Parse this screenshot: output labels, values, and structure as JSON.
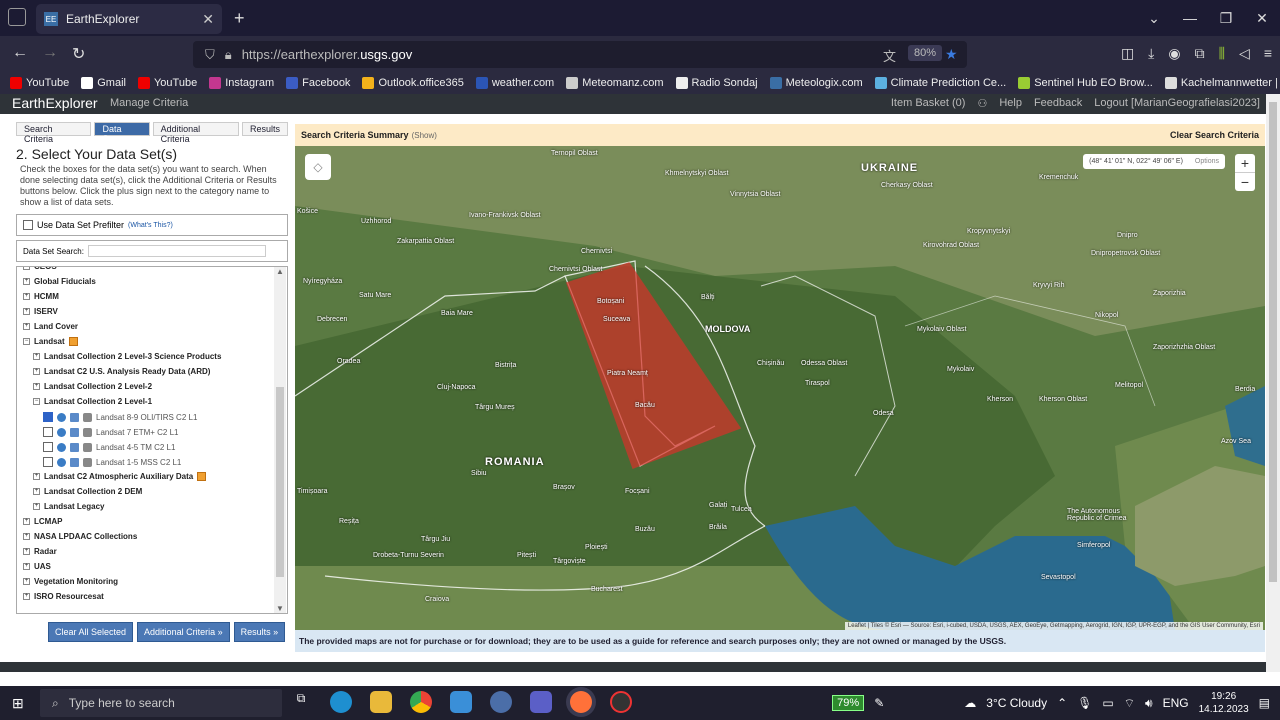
{
  "browser": {
    "tab_title": "EarthExplorer",
    "url_scheme": "https://earthexplorer.",
    "url_host": "usgs.gov",
    "zoom": "80%",
    "bookmarks": [
      {
        "label": "YouTube",
        "color": "#e00"
      },
      {
        "label": "Gmail",
        "color": "#fff"
      },
      {
        "label": "YouTube",
        "color": "#e00"
      },
      {
        "label": "Instagram",
        "color": "#c3378f"
      },
      {
        "label": "Facebook",
        "color": "#3b5cc4"
      },
      {
        "label": "Outlook.office365",
        "color": "#f3b21b"
      },
      {
        "label": "weather.com",
        "color": "#2b55b5"
      },
      {
        "label": "Meteomanz.com",
        "color": "#ccc"
      },
      {
        "label": "Radio Sondaj",
        "color": "#eee"
      },
      {
        "label": "Meteologix.com",
        "color": "#3a6ea5"
      },
      {
        "label": "Climate Prediction Ce...",
        "color": "#5cb0e0"
      },
      {
        "label": "Sentinel Hub EO Brow...",
        "color": "#9c3"
      },
      {
        "label": "Kachelmannwetter | W...",
        "color": "#ddd"
      }
    ]
  },
  "header": {
    "brand": "EarthExplorer",
    "manage": "Manage Criteria",
    "basket": "Item Basket (0)",
    "help": "Help",
    "feedback": "Feedback",
    "logout": "Logout [MarianGeografielasi2023]"
  },
  "left": {
    "tabs": [
      "Search Criteria",
      "Data Sets",
      "Additional Criteria",
      "Results"
    ],
    "title": "2. Select Your Data Set(s)",
    "instructions": "Check the boxes for the data set(s) you want to search. When done selecting data set(s), click the Additional Criteria or Results buttons below. Click the plus sign next to the category name to show a list of data sets.",
    "prefilter": "Use Data Set Prefilter",
    "whats_this": "(What's This?)",
    "search_label": "Data Set Search:",
    "tree": [
      {
        "label": "CEOS",
        "level": 0,
        "sign": "+"
      },
      {
        "label": "Global Fiducials",
        "level": 0,
        "sign": "+"
      },
      {
        "label": "HCMM",
        "level": 0,
        "sign": "+"
      },
      {
        "label": "ISERV",
        "level": 0,
        "sign": "+"
      },
      {
        "label": "Land Cover",
        "level": 0,
        "sign": "+"
      },
      {
        "label": "Landsat",
        "level": 0,
        "sign": "−",
        "badge": true
      },
      {
        "label": "Landsat Collection 2 Level-3 Science Products",
        "level": 1,
        "sign": "+"
      },
      {
        "label": "Landsat C2 U.S. Analysis Ready Data (ARD)",
        "level": 1,
        "sign": "+"
      },
      {
        "label": "Landsat Collection 2 Level-2",
        "level": 1,
        "sign": "+"
      },
      {
        "label": "Landsat Collection 2 Level-1",
        "level": 1,
        "sign": "−"
      },
      {
        "label": "Landsat 8-9 OLI/TIRS C2 L1",
        "level": 2,
        "checked": true
      },
      {
        "label": "Landsat 7 ETM+ C2 L1",
        "level": 2,
        "checked": false
      },
      {
        "label": "Landsat 4-5 TM C2 L1",
        "level": 2,
        "checked": false
      },
      {
        "label": "Landsat 1-5 MSS C2 L1",
        "level": 2,
        "checked": false
      },
      {
        "label": "Landsat C2 Atmospheric Auxiliary Data",
        "level": 1,
        "sign": "+",
        "badge": true
      },
      {
        "label": "Landsat Collection 2 DEM",
        "level": 1,
        "sign": "+"
      },
      {
        "label": "Landsat Legacy",
        "level": 1,
        "sign": "+"
      },
      {
        "label": "LCMAP",
        "level": 0,
        "sign": "+"
      },
      {
        "label": "NASA LPDAAC Collections",
        "level": 0,
        "sign": "+"
      },
      {
        "label": "Radar",
        "level": 0,
        "sign": "+"
      },
      {
        "label": "UAS",
        "level": 0,
        "sign": "+"
      },
      {
        "label": "Vegetation Monitoring",
        "level": 0,
        "sign": "+"
      },
      {
        "label": "ISRO Resourcesat",
        "level": 0,
        "sign": "+"
      }
    ],
    "buttons": [
      "Clear All Selected",
      "Additional Criteria »",
      "Results »"
    ]
  },
  "map": {
    "summary": "Search Criteria Summary",
    "show": "(Show)",
    "clear": "Clear Search Criteria",
    "coords": "(48° 41' 01\" N, 022° 49' 06\" E)",
    "options": "Options",
    "attribution": "Leaflet | Tiles © Esri — Source: Esri, i-cubed, USDA, USGS, AEX, GeoEye, Getmapping, Aerogrid, IGN, IGP, UPR-EGP, and the GIS User Community, Esri",
    "disclaimer": "The provided maps are not for purchase or for download; they are to be used as a guide for reference and search purposes only; they are not owned or managed by the USGS.",
    "labels": {
      "ukraine": "UKRAINE",
      "moldova": "MOLDOVA",
      "romania": "ROMANIA",
      "ternopil": "Ternopil Oblast",
      "khmelnytskyi": "Khmelnytskyi Oblast",
      "vinnytsia": "Vinnytsia Oblast",
      "cherkasy": "Cherkasy Oblast",
      "kremenchuk": "Kremenchuk",
      "kirovohrad": "Kirovohrad Oblast",
      "kropyvnytskyi": "Kropyvnytskyi",
      "dnipro": "Dnipro",
      "dnipropetrovsk": "Dnipropetrovsk Oblast",
      "kryvyi": "Kryvyi Rih",
      "zaporizhia": "Zaporizhia",
      "zaporizhia_obl": "Zaporizhzhia Oblast",
      "nikopol": "Nikopol",
      "ivano": "Ivano-Frankivsk Oblast",
      "uzhhorod": "Uzhhorod",
      "zakarpattia": "Zakarpattia Oblast",
      "chernivtsi": "Chernivtsi",
      "chernivtsi_obl": "Chernivtsi Oblast",
      "nyiregyhaza": "Nyíregyháza",
      "debrecen": "Debrecen",
      "satu": "Satu Mare",
      "baia": "Baia Mare",
      "oradea": "Oradea",
      "cluj": "Cluj-Napoca",
      "bistrita": "Bistrița",
      "targu": "Târgu Mureș",
      "botosani": "Botoșani",
      "suceava": "Suceava",
      "piatra": "Piatra Neamț",
      "bacau": "Bacău",
      "balti": "Bălți",
      "chisinau": "Chișinău",
      "odessa_obl": "Odessa Oblast",
      "odesa": "Odesa",
      "tiraspol": "Tiraspol",
      "mykolaiv_obl": "Mykolaiv Oblast",
      "mykolaiv": "Mykolaiv",
      "kherson": "Kherson",
      "kherson_obl": "Kherson Oblast",
      "melitopol": "Melitopol",
      "berdia": "Berdia",
      "azov": "Azov Sea",
      "sibiu": "Sibiu",
      "brasov": "Brașov",
      "focsani": "Focșani",
      "galati": "Galați",
      "braila": "Brăila",
      "buzau": "Buzău",
      "ploiesti": "Ploiești",
      "pitesti": "Pitești",
      "targoviste": "Târgoviște",
      "bucharest": "Bucharest",
      "craiova": "Craiova",
      "resita": "Reșița",
      "drobeta": "Drobeta-Turnu Severin",
      "targu_jiu": "Târgu Jiu",
      "crimea": "The Autonomous Republic of Crimea",
      "simferopol": "Simferopol",
      "sevastopol": "Sevastopol",
      "kosice": "Košice",
      "tulcea": "Tulcea",
      "istanbul": "",
      "timisoara": "Timișoara"
    }
  },
  "taskbar": {
    "search": "Type here to search",
    "battery": "79%",
    "weather": "3°C  Cloudy",
    "lang": "ENG",
    "time": "19:26",
    "date": "14.12.2023"
  }
}
